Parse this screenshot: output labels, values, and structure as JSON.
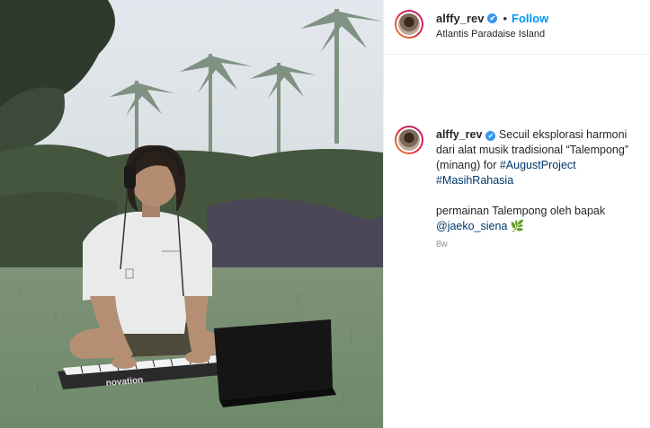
{
  "post": {
    "username": "alffy_rev",
    "follow_label": "Follow",
    "separator": "•",
    "location": "Atlantis Paradaise Island",
    "verified_icon": "✔"
  },
  "caption": {
    "username": "alffy_rev",
    "text1": " Secuil eksplorasi harmoni dari alat musik tradisional “Talempong” (minang) for ",
    "hashtag1": "#AugustProject",
    "hashtag2": "#MasihRahasia",
    "text2": "permainan Talempong oleh bapak ",
    "mention": "@jaeko_siena",
    "emoji": "🌿",
    "time": "8w"
  },
  "media": {
    "keyboard_brand": "novation"
  },
  "colors": {
    "link": "#00376b",
    "follow": "#0095f6",
    "verified": "#3897f0"
  }
}
